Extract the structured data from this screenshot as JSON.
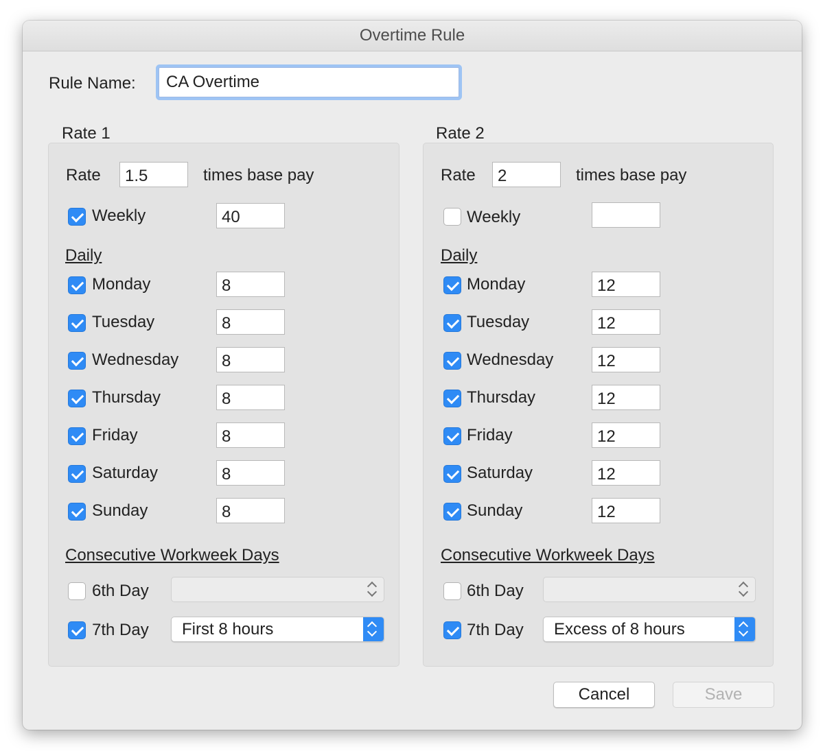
{
  "window": {
    "title": "Overtime Rule"
  },
  "rule_name": {
    "label": "Rule Name:",
    "value": "CA Overtime"
  },
  "rates": [
    {
      "group_label": "Rate 1",
      "rate_label": "Rate",
      "rate_value": "1.5",
      "rate_suffix": "times base pay",
      "weekly": {
        "label": "Weekly",
        "checked": true,
        "value": "40"
      },
      "daily_heading": "Daily",
      "days": [
        {
          "label": "Monday",
          "checked": true,
          "value": "8"
        },
        {
          "label": "Tuesday",
          "checked": true,
          "value": "8"
        },
        {
          "label": "Wednesday",
          "checked": true,
          "value": "8"
        },
        {
          "label": "Thursday",
          "checked": true,
          "value": "8"
        },
        {
          "label": "Friday",
          "checked": true,
          "value": "8"
        },
        {
          "label": "Saturday",
          "checked": true,
          "value": "8"
        },
        {
          "label": "Sunday",
          "checked": true,
          "value": "8"
        }
      ],
      "consecutive_heading": "Consecutive Workweek Days",
      "day6": {
        "label": "6th Day",
        "checked": false,
        "value": ""
      },
      "day7": {
        "label": "7th Day",
        "checked": true,
        "value": "First 8 hours"
      }
    },
    {
      "group_label": "Rate 2",
      "rate_label": "Rate",
      "rate_value": "2",
      "rate_suffix": "times base pay",
      "weekly": {
        "label": "Weekly",
        "checked": false,
        "value": ""
      },
      "daily_heading": "Daily",
      "days": [
        {
          "label": "Monday",
          "checked": true,
          "value": "12"
        },
        {
          "label": "Tuesday",
          "checked": true,
          "value": "12"
        },
        {
          "label": "Wednesday",
          "checked": true,
          "value": "12"
        },
        {
          "label": "Thursday",
          "checked": true,
          "value": "12"
        },
        {
          "label": "Friday",
          "checked": true,
          "value": "12"
        },
        {
          "label": "Saturday",
          "checked": true,
          "value": "12"
        },
        {
          "label": "Sunday",
          "checked": true,
          "value": "12"
        }
      ],
      "consecutive_heading": "Consecutive Workweek Days",
      "day6": {
        "label": "6th Day",
        "checked": false,
        "value": ""
      },
      "day7": {
        "label": "7th Day",
        "checked": true,
        "value": "Excess of 8 hours"
      }
    }
  ],
  "buttons": {
    "cancel": "Cancel",
    "save": "Save"
  },
  "colors": {
    "accent": "#2f8bf5",
    "focus_ring": "#9ec4f4",
    "window_bg": "#ececec",
    "group_bg": "#e3e3e3"
  },
  "icons": {
    "checkbox": "checkmark-icon",
    "popup": "up-down-chevron-icon"
  }
}
